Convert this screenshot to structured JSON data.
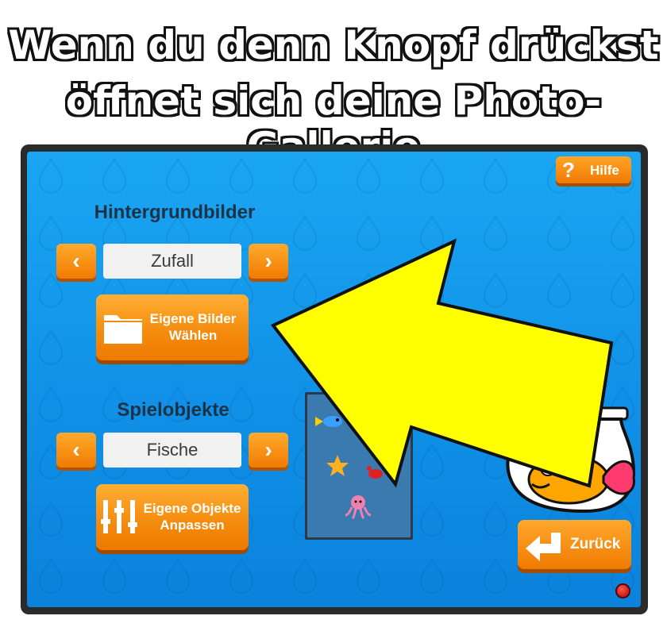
{
  "headline": {
    "line1": "Wenn du denn Knopf drückst",
    "line2": "öffnet sich deine Photo-Gallerie"
  },
  "help": {
    "icon": "question-icon",
    "label": "Hilfe"
  },
  "backgrounds": {
    "title": "Hintergrundbilder",
    "value": "Zufall",
    "prev_icon": "chevron-left-icon",
    "next_icon": "chevron-right-icon",
    "own_button_line1": "Eigene Bilder",
    "own_button_line2": "Wählen",
    "own_button_icon": "folder-icon"
  },
  "game_objects": {
    "title": "Spielobjekte",
    "value": "Fische",
    "prev_icon": "chevron-left-icon",
    "next_icon": "chevron-right-icon",
    "own_button_line1": "Eigene Objekte",
    "own_button_line2": "Anpassen",
    "own_button_icon": "sliders-icon"
  },
  "preview": {
    "items": [
      "fish-icon",
      "starfish-icon",
      "crab-icon",
      "octopus-icon"
    ]
  },
  "mascot": "goldfish-bowl-icon",
  "back": {
    "label": "Zurück",
    "icon": "return-arrow-icon"
  },
  "status": {
    "led_color": "#d00000"
  },
  "colors": {
    "accent": "#f58a0a",
    "screen_bg": "#1298ea",
    "pointer_arrow": "#ffff00"
  }
}
